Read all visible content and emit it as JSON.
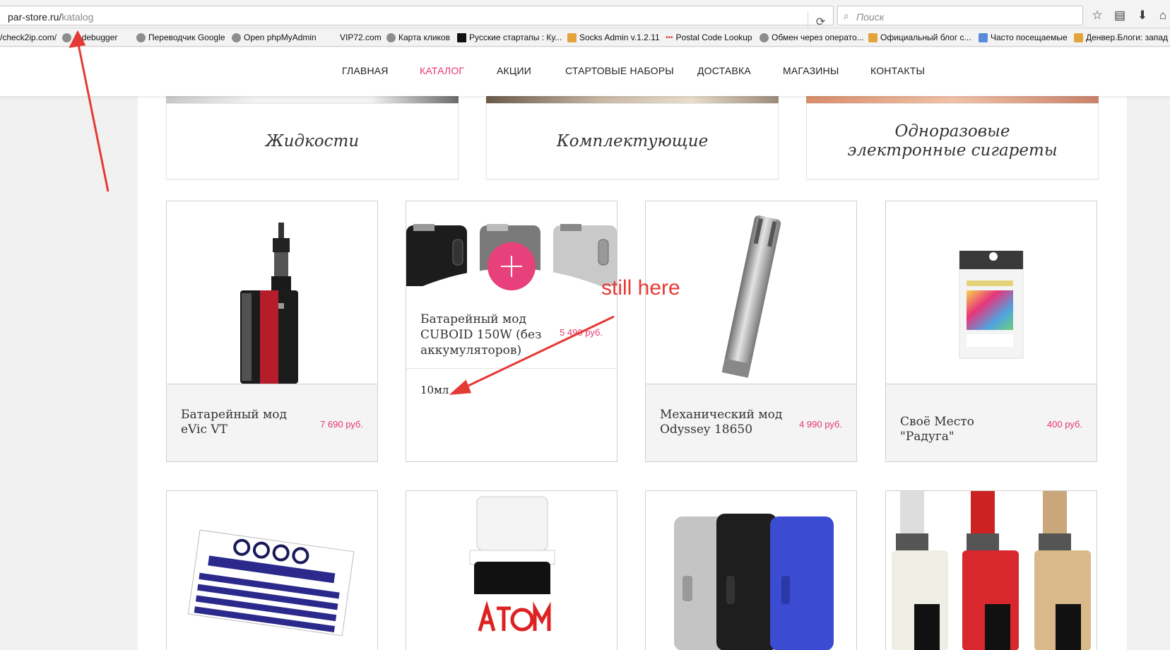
{
  "browser": {
    "url_domain": "par-store.ru/",
    "url_path": "katalog",
    "search_placeholder": "Поиск",
    "bookmarks": [
      "/check2ip.com/",
      "rt debugger",
      "Переводчик Google",
      "Open phpMyAdmin",
      "VIP72.com",
      "Карта кликов",
      "Русские стартапы : Ку...",
      "Socks Admin v.1.2.11",
      "Postal Code Lookup",
      "Обмен через операто...",
      "Официальный блог с...",
      "Часто посещаемые",
      "Денвер.Блоги: запад"
    ]
  },
  "nav": {
    "items": [
      "ГЛАВНАЯ",
      "КАТАЛОГ",
      "АКЦИИ",
      "СТАРТОВЫЕ НАБОРЫ",
      "ДОСТАВКА",
      "МАГАЗИНЫ",
      "КОНТАКТЫ"
    ],
    "active": "КАТАЛОГ",
    "active_color": "#e8356b"
  },
  "categories": [
    "Жидкости",
    "Комплектующие",
    "Одноразовые электронные сигареты"
  ],
  "products": [
    {
      "name": "Батарейный мод eVic VT",
      "price": "7 690 руб."
    },
    {
      "name": "Батарейный мод CUBOID 150W (без аккумуляторов)",
      "price": "5 490 руб.",
      "volume": "10мл"
    },
    {
      "name": "Механический мод Odyssey 18650",
      "price": "4 990 руб."
    },
    {
      "name": "Своё Место \"Радуга\"",
      "price": "400 руб."
    }
  ],
  "row2_images": [
    "noqo-icon",
    "atom-bottle-icon",
    "silicone-case-icon",
    "mod-kit-icon"
  ],
  "annotation": {
    "text": "still here",
    "color": "#e53935"
  }
}
